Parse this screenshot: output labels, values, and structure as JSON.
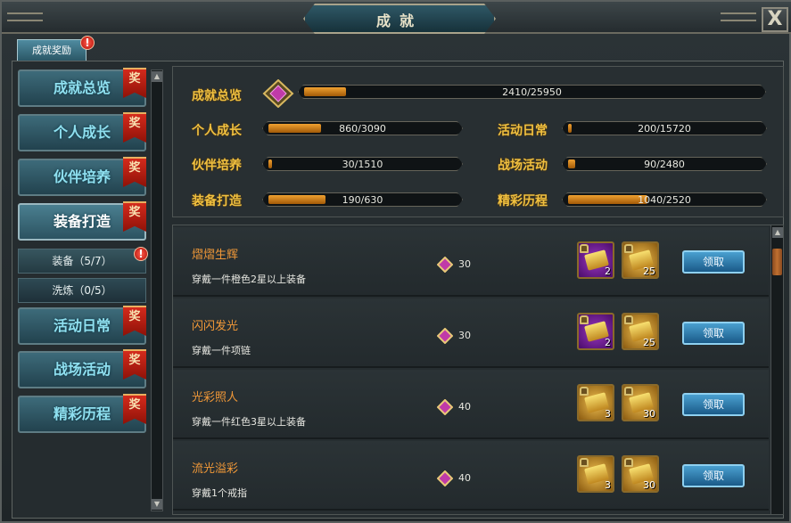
{
  "window": {
    "title": "成就",
    "close_label": "X"
  },
  "tabs": [
    {
      "label": "成就奖励",
      "badge": "!"
    }
  ],
  "sidebar": {
    "items": [
      {
        "label": "成就总览",
        "tag": "奖"
      },
      {
        "label": "个人成长",
        "tag": "奖"
      },
      {
        "label": "伙伴培养",
        "tag": "奖"
      },
      {
        "label": "装备打造",
        "tag": "奖"
      },
      {
        "label": "活动日常",
        "tag": "奖"
      },
      {
        "label": "战场活动",
        "tag": "奖"
      },
      {
        "label": "精彩历程",
        "tag": "奖"
      }
    ],
    "subitems": [
      {
        "label": "装备（5/7）",
        "badge": "!"
      },
      {
        "label": "洗炼（0/5）"
      }
    ]
  },
  "summary": {
    "overview": {
      "label": "成就总览",
      "progress": "2410/25950",
      "value": 2410,
      "max": 25950
    },
    "categories": [
      {
        "label": "个人成长",
        "progress": "860/3090",
        "value": 860,
        "max": 3090
      },
      {
        "label": "活动日常",
        "progress": "200/15720",
        "value": 200,
        "max": 15720
      },
      {
        "label": "伙伴培养",
        "progress": "30/1510",
        "value": 30,
        "max": 1510
      },
      {
        "label": "战场活动",
        "progress": "90/2480",
        "value": 90,
        "max": 2480
      },
      {
        "label": "装备打造",
        "progress": "190/630",
        "value": 190,
        "max": 630
      },
      {
        "label": "精彩历程",
        "progress": "1040/2520",
        "value": 1040,
        "max": 2520
      }
    ]
  },
  "achievements": [
    {
      "name": "熠熠生辉",
      "desc": "穿戴一件橙色2星以上装备",
      "points": "30",
      "rewards": [
        {
          "type": "purple",
          "count": "2"
        },
        {
          "type": "gold",
          "count": "25"
        }
      ],
      "button": "领取"
    },
    {
      "name": "闪闪发光",
      "desc": "穿戴一件项链",
      "points": "30",
      "rewards": [
        {
          "type": "purple",
          "count": "2"
        },
        {
          "type": "gold",
          "count": "25"
        }
      ],
      "button": "领取"
    },
    {
      "name": "光彩照人",
      "desc": "穿戴一件红色3星以上装备",
      "points": "40",
      "rewards": [
        {
          "type": "gold",
          "count": "3"
        },
        {
          "type": "gold",
          "count": "30"
        }
      ],
      "button": "领取"
    },
    {
      "name": "流光溢彩",
      "desc": "穿戴1个戒指",
      "points": "40",
      "rewards": [
        {
          "type": "gold",
          "count": "3"
        },
        {
          "type": "gold",
          "count": "30"
        }
      ],
      "button": "领取"
    }
  ],
  "icons": {
    "gem": "diamond-gem-icon",
    "reward": "scroll-reward-icon",
    "lock": "lock-icon",
    "scroll_up": "arrow-up-icon",
    "scroll_down": "arrow-down-icon"
  },
  "colors": {
    "accent_gold": "#f0c040",
    "claim_blue": "#2a7ab0",
    "tag_red": "#c0201a"
  }
}
